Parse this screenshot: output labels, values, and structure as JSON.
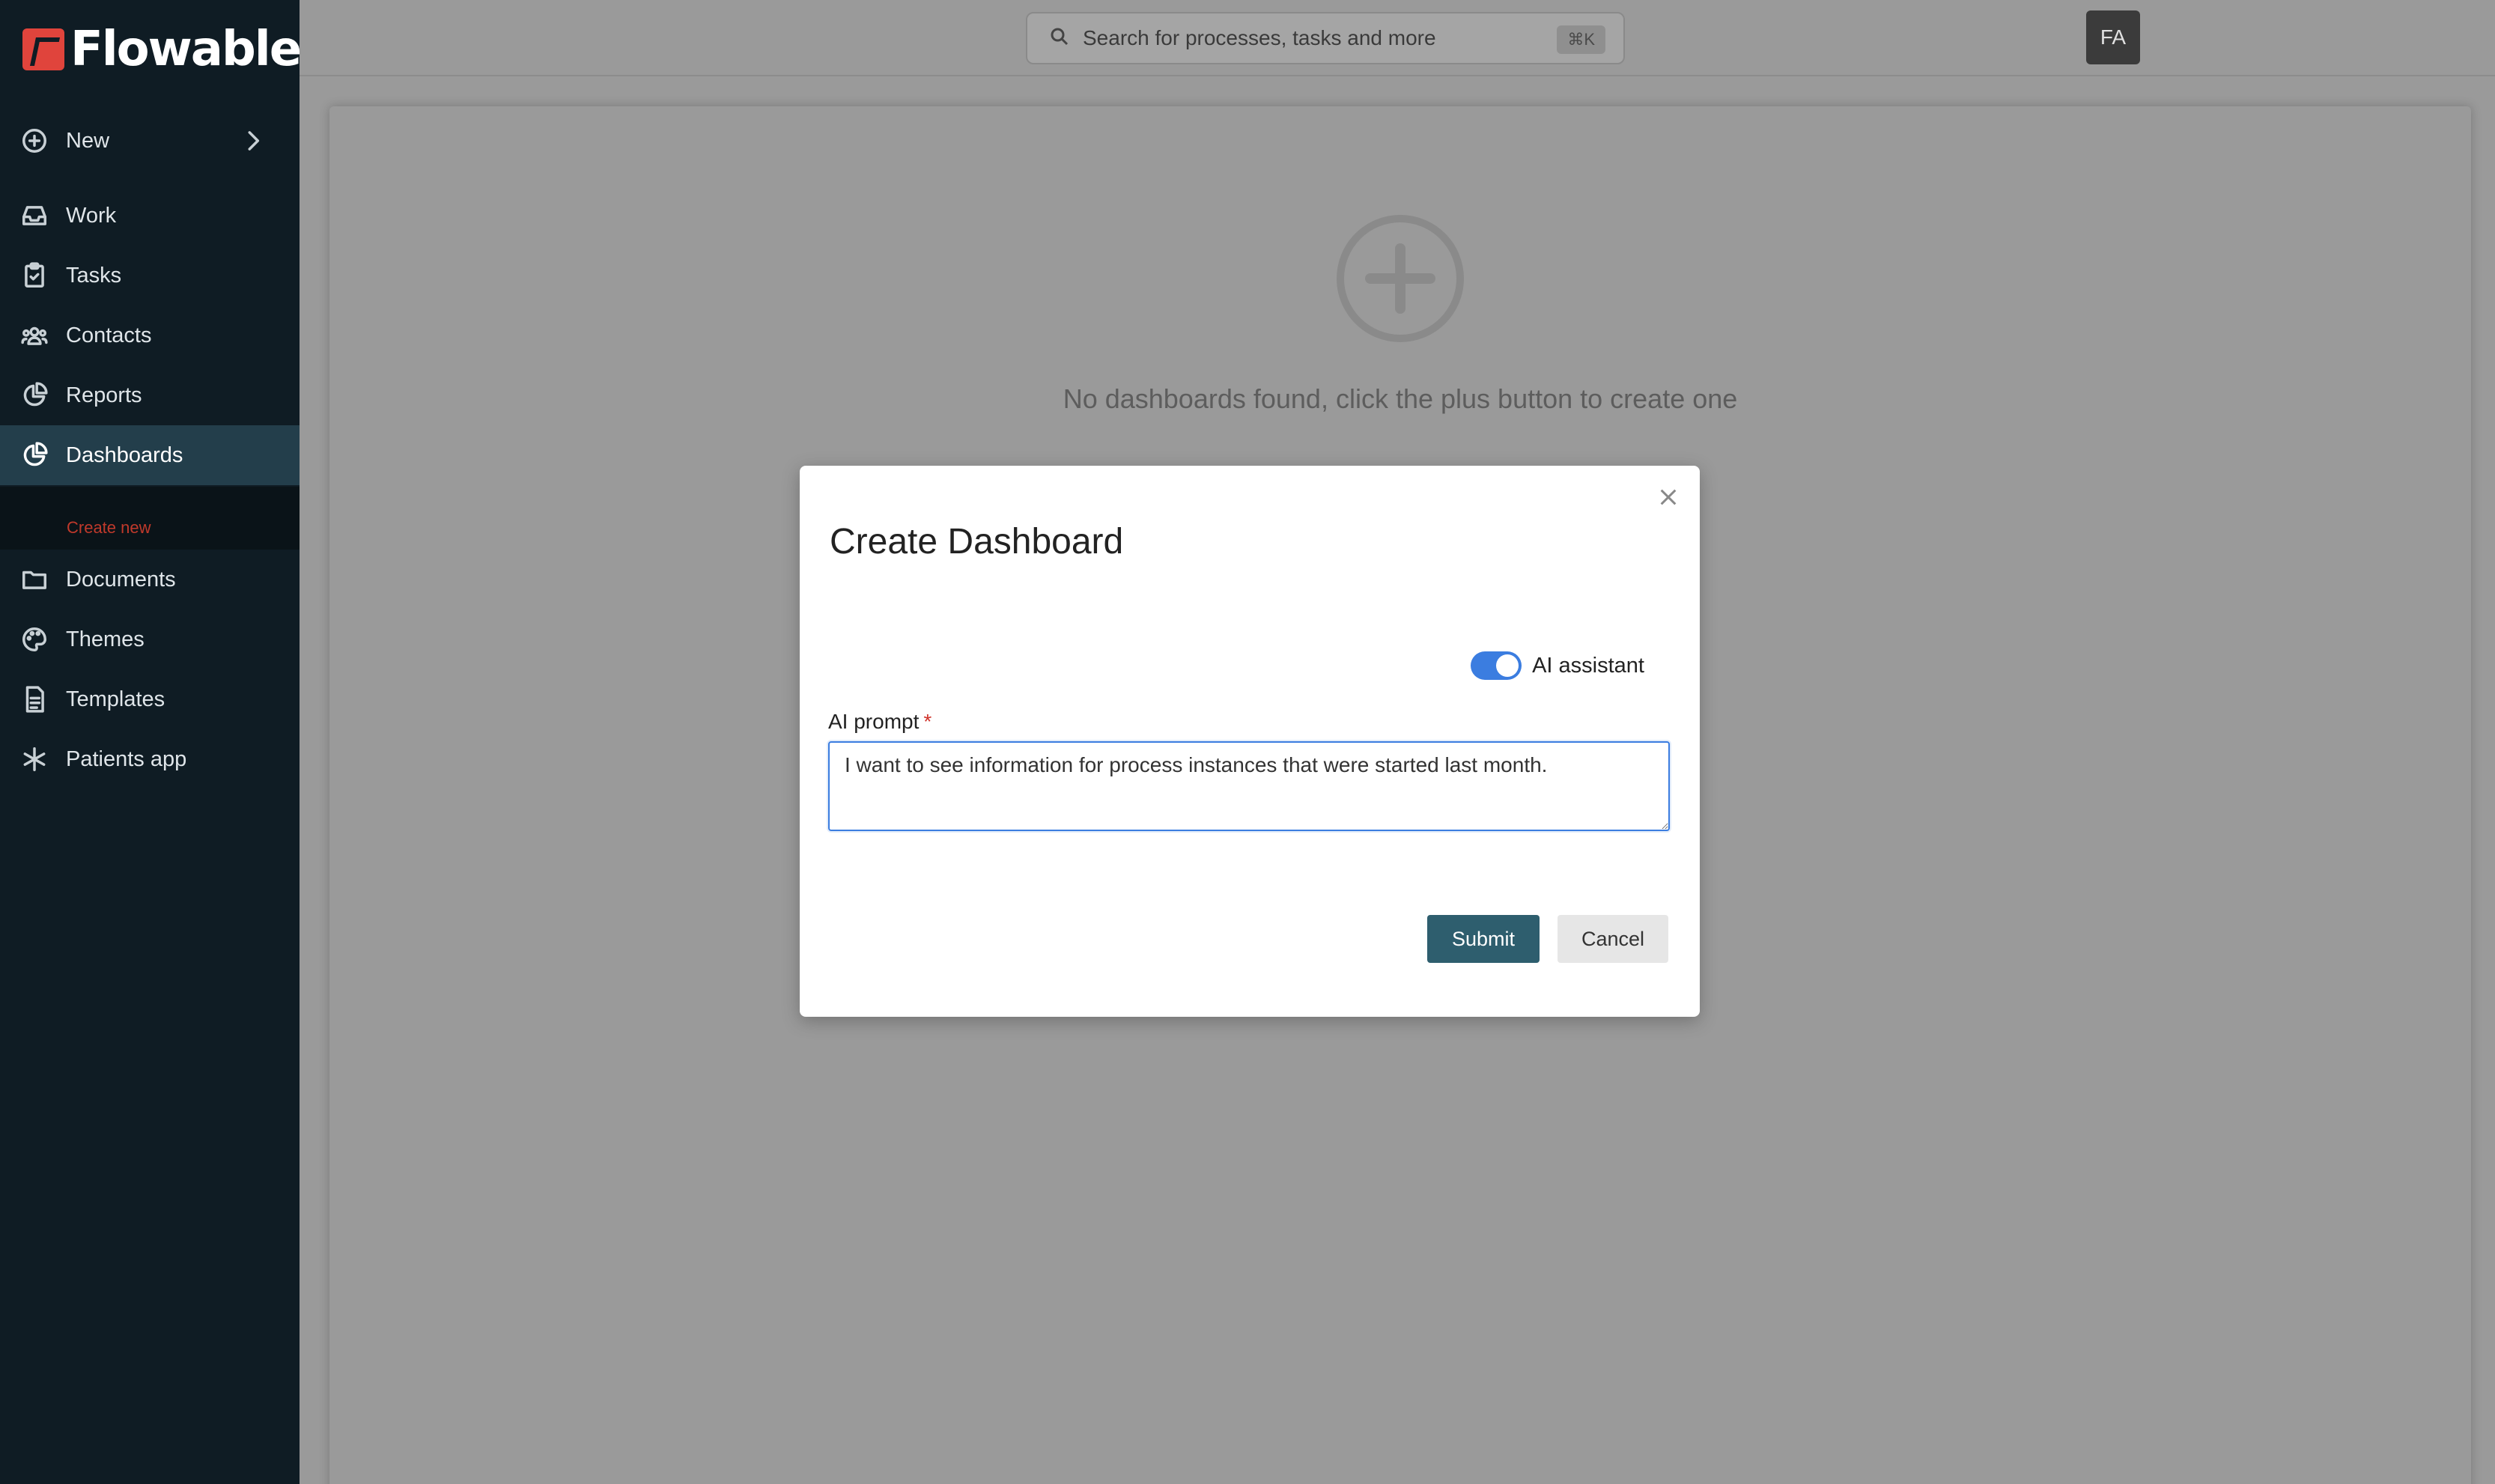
{
  "app": {
    "logo_text": "Flowable"
  },
  "sidebar": {
    "items": [
      {
        "label": "New",
        "icon": "plus-circle-icon"
      },
      {
        "label": "Work",
        "icon": "inbox-icon"
      },
      {
        "label": "Tasks",
        "icon": "clipboard-check-icon"
      },
      {
        "label": "Contacts",
        "icon": "users-icon"
      },
      {
        "label": "Reports",
        "icon": "pie-chart-icon"
      },
      {
        "label": "Dashboards",
        "icon": "dashboard-pie-icon"
      },
      {
        "label": "Documents",
        "icon": "folder-icon"
      },
      {
        "label": "Themes",
        "icon": "palette-icon"
      },
      {
        "label": "Templates",
        "icon": "file-text-icon"
      },
      {
        "label": "Patients app",
        "icon": "asterisk-icon"
      }
    ],
    "active": "Dashboards",
    "sub_item": "Create new"
  },
  "header": {
    "search_placeholder": "Search for processes, tasks and more",
    "shortcut": "⌘K",
    "avatar_initials": "FA"
  },
  "main": {
    "empty_message": "No dashboards found, click the plus button to create one"
  },
  "modal": {
    "title": "Create Dashboard",
    "toggle_label": "AI assistant",
    "toggle_on": true,
    "field_label": "AI prompt",
    "required_marker": "*",
    "prompt_value": "I want to see information for process instances that were started last month.",
    "submit_label": "Submit",
    "cancel_label": "Cancel"
  },
  "colors": {
    "sidebar_bg": "#0f1c24",
    "active_item_bg": "#233e4b",
    "accent_blue": "#3b7de0",
    "submit_bg": "#2e5e6e",
    "logo_red": "#e0443c"
  }
}
